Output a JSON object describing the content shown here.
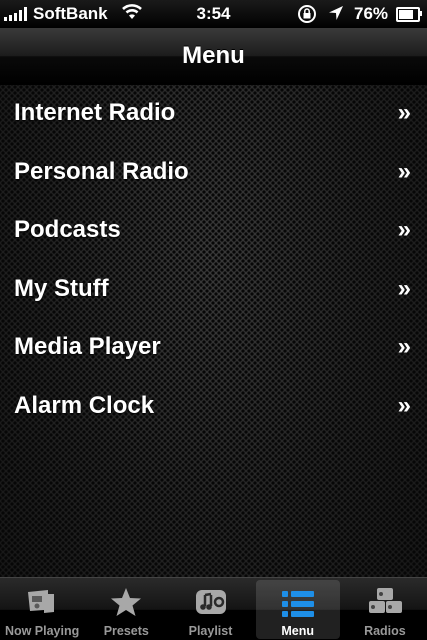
{
  "status_bar": {
    "carrier": "SoftBank",
    "time": "3:54",
    "battery_percent": "76%",
    "battery_level": 0.76
  },
  "nav": {
    "title": "Menu"
  },
  "menu": {
    "items": [
      {
        "label": "Internet Radio",
        "chevron": "»"
      },
      {
        "label": "Personal Radio",
        "chevron": "»"
      },
      {
        "label": "Podcasts",
        "chevron": "»"
      },
      {
        "label": "My Stuff",
        "chevron": "»"
      },
      {
        "label": "Media Player",
        "chevron": "»"
      },
      {
        "label": "Alarm Clock",
        "chevron": "»"
      }
    ]
  },
  "tabs": [
    {
      "label": "Now Playing",
      "icon": "now-playing-icon",
      "active": false
    },
    {
      "label": "Presets",
      "icon": "star-icon",
      "active": false
    },
    {
      "label": "Playlist",
      "icon": "playlist-icon",
      "active": false
    },
    {
      "label": "Menu",
      "icon": "list-icon",
      "active": true
    },
    {
      "label": "Radios",
      "icon": "radios-icon",
      "active": false
    }
  ],
  "colors": {
    "active_icon": "#1e8fe8",
    "inactive_icon": "#a8a8a8"
  }
}
